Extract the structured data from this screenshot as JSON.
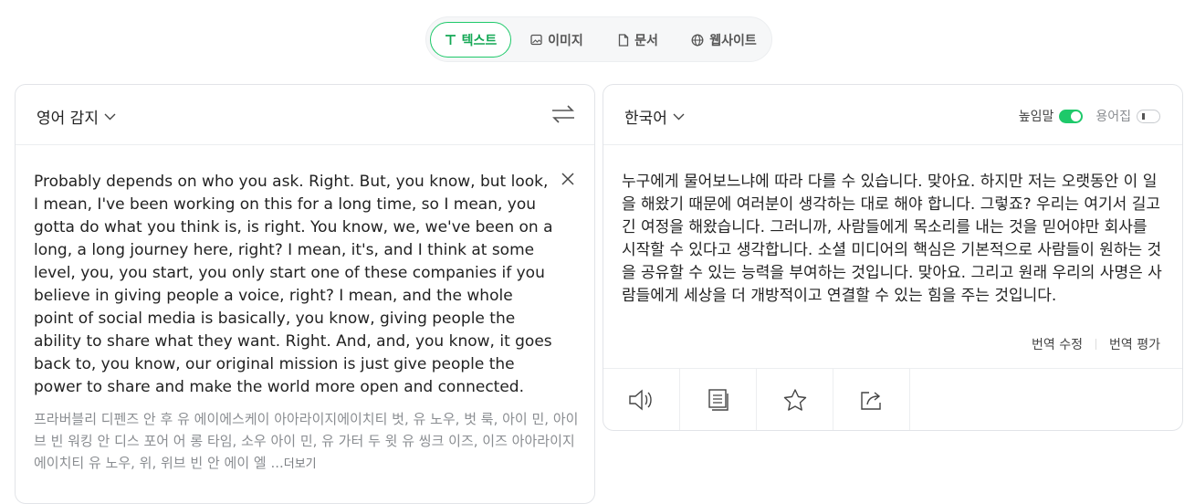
{
  "tabs": [
    {
      "label": "텍스트",
      "icon": "text-icon",
      "active": true
    },
    {
      "label": "이미지",
      "icon": "image-icon",
      "active": false
    },
    {
      "label": "문서",
      "icon": "document-icon",
      "active": false
    },
    {
      "label": "웹사이트",
      "icon": "globe-icon",
      "active": false
    }
  ],
  "source": {
    "language": "영어 감지",
    "text": "Probably depends on who you ask. Right. But, you know, but look, I mean, I've been working on this for a long time, so I mean, you gotta do what you think is, is right. You know, we, we've been on a long, a long journey here, right? I mean, it's, and I think at some level, you, you start, you only start one of these companies if you believe in giving people a voice, right? I mean, and the whole point of social media is basically, you know, giving people the ability to share what they want. Right. And, and, you know, it goes back to, you know, our original mission is just give people the power to share and make the world more open and connected.",
    "pronunciation": "프라버블리 디펜즈 안 후 유 에이에스케이 아아라이지에이치티 벗, 유 노우, 벗 룩, 아이 민, 아이브 빈 워킹 안 디스 포어 어 롱 타임, 소우 아이 민, 유 가터 두 윗 유 씽크 이즈, 이즈 아아라이지에이치티 유 노우, 위, 위브 빈 안 에이 엘 ...",
    "more_label": "더보기"
  },
  "target": {
    "language": "한국어",
    "honorific_label": "높임말",
    "honorific_on": true,
    "glossary_label": "용어집",
    "glossary_on": false,
    "text": "누구에게 물어보느냐에 따라 다를 수 있습니다. 맞아요. 하지만 저는 오랫동안 이 일을 해왔기 때문에 여러분이 생각하는 대로 해야 합니다. 그렇죠? 우리는 여기서 길고 긴 여정을 해왔습니다. 그러니까, 사람들에게 목소리를 내는 것을 믿어야만 회사를 시작할 수 있다고 생각합니다. 소셜 미디어의 핵심은 기본적으로 사람들이 원하는 것을 공유할 수 있는 능력을 부여하는 것입니다. 맞아요. 그리고 원래 우리의 사명은 사람들에게 세상을 더 개방적이고 연결할 수 있는 힘을 주는 것입니다.",
    "edit_label": "번역 수정",
    "rate_label": "번역 평가"
  },
  "actions": [
    "speaker-icon",
    "copy-icon",
    "star-icon",
    "share-icon"
  ],
  "colors": {
    "accent": "#1ec96a",
    "accent_text": "#14a855",
    "border": "#e2e4e8"
  }
}
